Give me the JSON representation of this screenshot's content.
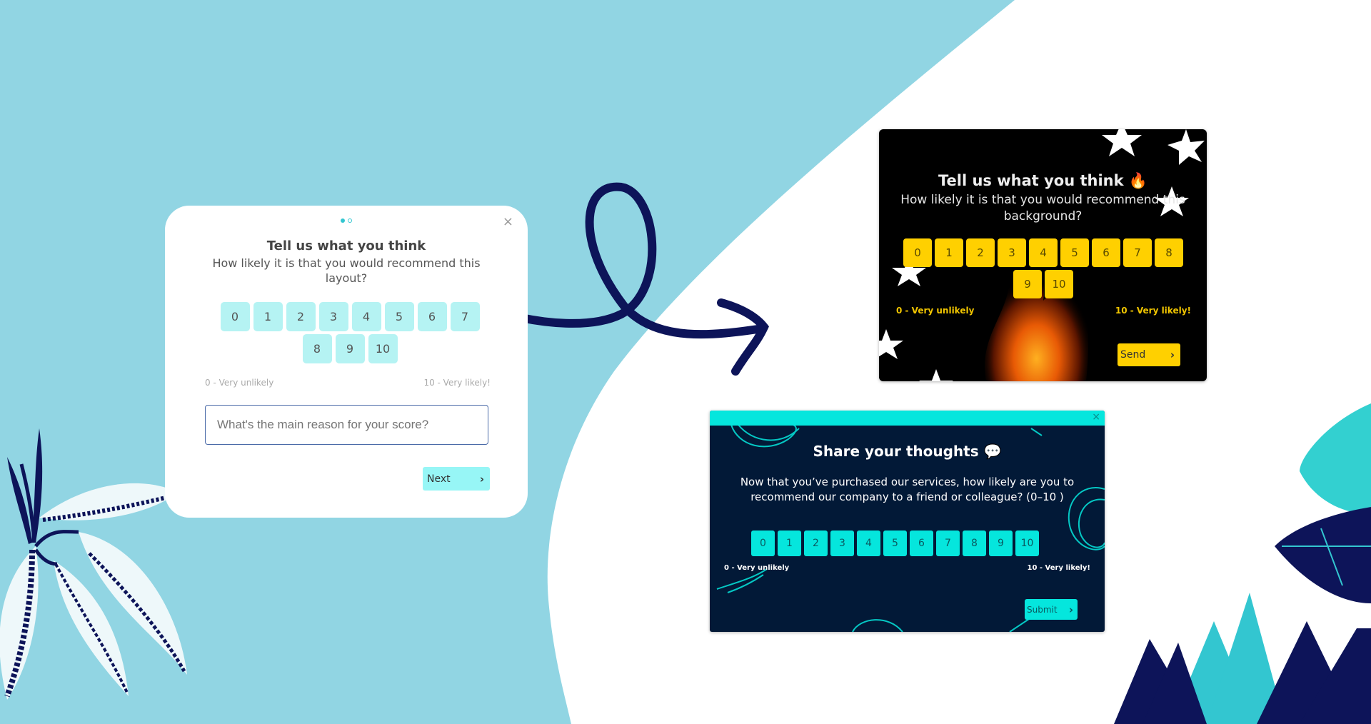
{
  "colors": {
    "background_blue": "#91d5e3",
    "white_region": "#ffffff",
    "navy": "#0d1459",
    "teal": "#33c6d0",
    "card1_button": "#b5f3f3",
    "card1_next": "#97f6f6",
    "fire_button": "#ffd000",
    "navy_card_bg": "#021937",
    "navy_card_accent": "#05e6dd"
  },
  "survey_light": {
    "step_dots": [
      {
        "state": "active"
      },
      {
        "state": "inactive"
      }
    ],
    "close_icon": "×",
    "title": "Tell us what you think",
    "question": "How likely it is that you would recommend this layout?",
    "scale": [
      "0",
      "1",
      "2",
      "3",
      "4",
      "5",
      "6",
      "7",
      "8",
      "9",
      "10"
    ],
    "label_low": "0 - Very unlikely",
    "label_high": "10 - Very likely!",
    "input_placeholder": "What's the main reason for your score?",
    "next_label": "Next",
    "chevron": "›"
  },
  "survey_fire": {
    "title": "Tell us what you think 🔥",
    "question": "How likely it is that you would recommend this background?",
    "scale": [
      "0",
      "1",
      "2",
      "3",
      "4",
      "5",
      "6",
      "7",
      "8",
      "9",
      "10"
    ],
    "label_low": "0 - Very unlikely",
    "label_high": "10 - Very likely!",
    "send_label": "Send",
    "chevron": "›"
  },
  "survey_navy": {
    "close_icon": "×",
    "title": "Share your thoughts 💬",
    "question": "Now that you’ve purchased our services, how likely are you to recommend our company to a friend or colleague? (0–10 )",
    "scale": [
      "0",
      "1",
      "2",
      "3",
      "4",
      "5",
      "6",
      "7",
      "8",
      "9",
      "10"
    ],
    "label_low": "0 - Very unlikely",
    "label_high": "10 - Very likely!",
    "submit_label": "Submit",
    "chevron": "›"
  }
}
